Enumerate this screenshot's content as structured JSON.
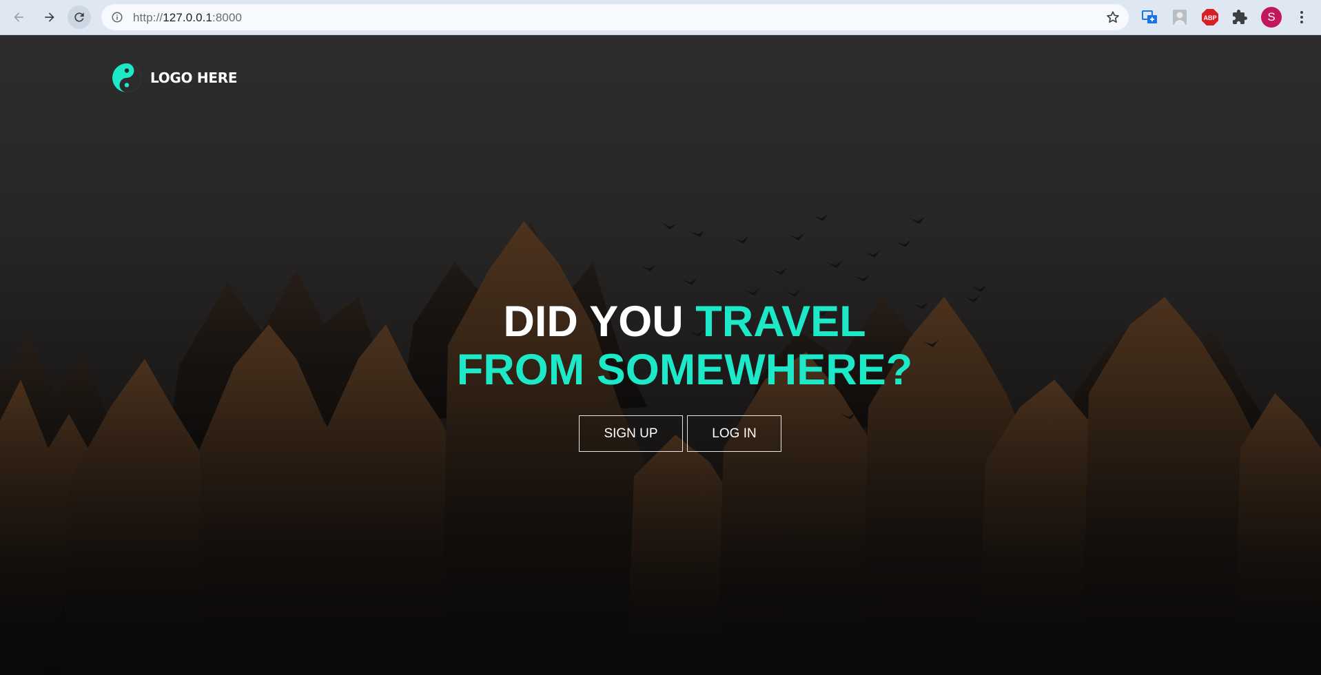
{
  "browser": {
    "url_proto": "http://",
    "url_host": "127.0.0.1",
    "url_port": ":8000",
    "profile_initial": "S",
    "extensions": [
      "translate-icon",
      "profile-image-icon",
      "adblock-plus-icon",
      "puzzle-icon"
    ]
  },
  "page": {
    "logo_text": "LOGO HERE",
    "headline_white": "DID YOU ",
    "headline_accent": "TRAVEL FROM SOMEWHERE?",
    "signup_label": "SIGN UP",
    "login_label": "LOG IN"
  },
  "colors": {
    "accent": "#1de9c8",
    "avatar": "#c2185b",
    "chrome_bar": "#dfe7f3"
  }
}
